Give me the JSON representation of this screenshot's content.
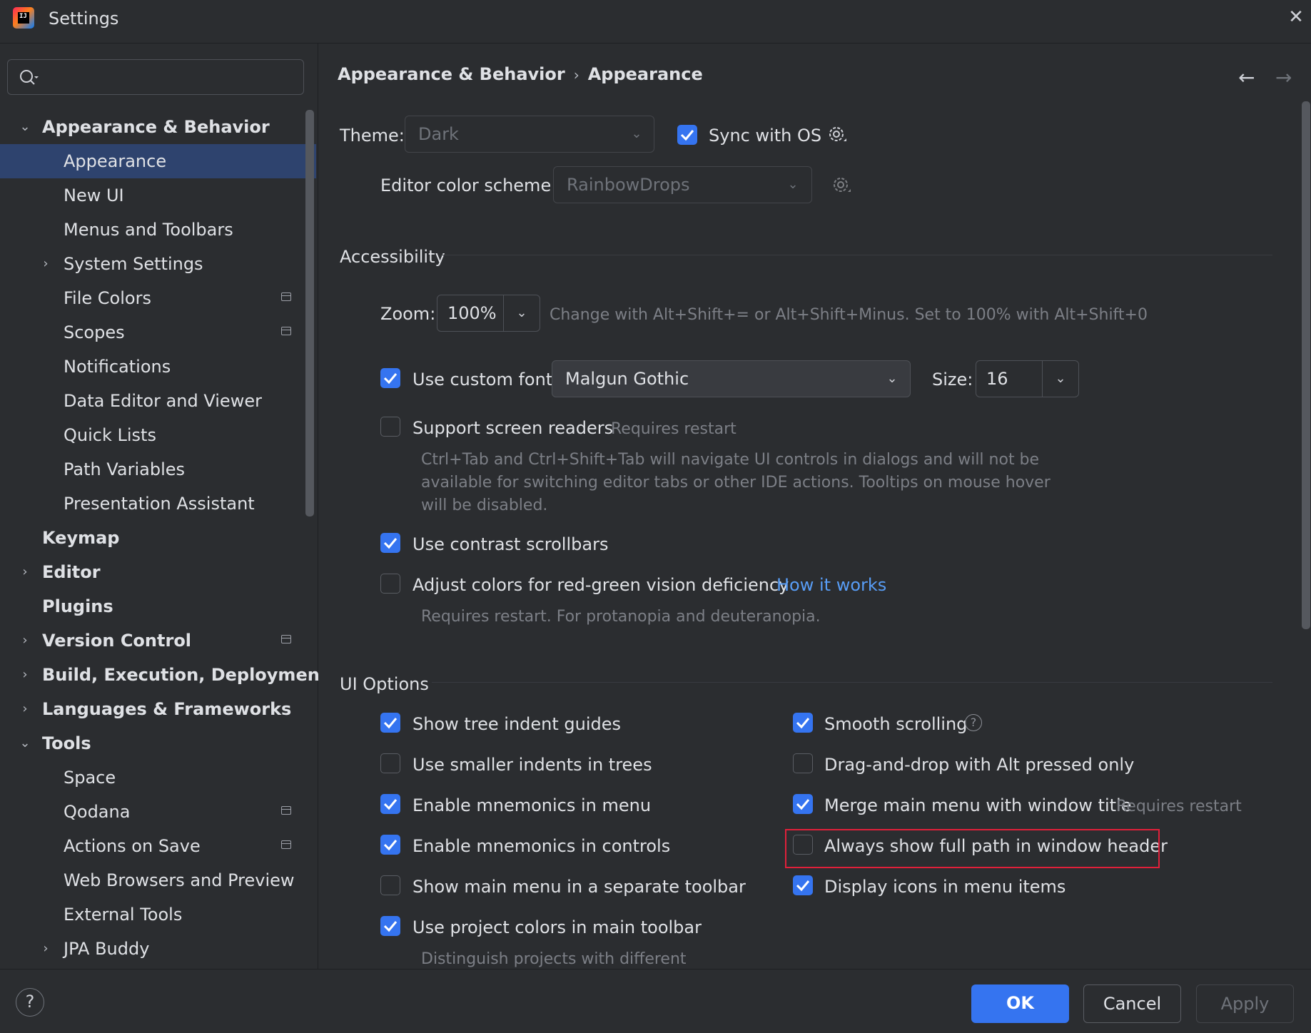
{
  "window": {
    "title": "Settings"
  },
  "search": {
    "placeholder": ""
  },
  "sidebar": {
    "items": [
      {
        "label": "Appearance & Behavior",
        "expanded": true
      },
      {
        "label": "Appearance",
        "selected": true
      },
      {
        "label": "New UI"
      },
      {
        "label": "Menus and Toolbars"
      },
      {
        "label": "System Settings"
      },
      {
        "label": "File Colors"
      },
      {
        "label": "Scopes"
      },
      {
        "label": "Notifications"
      },
      {
        "label": "Data Editor and Viewer"
      },
      {
        "label": "Quick Lists"
      },
      {
        "label": "Path Variables"
      },
      {
        "label": "Presentation Assistant"
      },
      {
        "label": "Keymap"
      },
      {
        "label": "Editor"
      },
      {
        "label": "Plugins"
      },
      {
        "label": "Version Control"
      },
      {
        "label": "Build, Execution, Deployment"
      },
      {
        "label": "Languages & Frameworks"
      },
      {
        "label": "Tools",
        "expanded": true
      },
      {
        "label": "Space"
      },
      {
        "label": "Qodana"
      },
      {
        "label": "Actions on Save"
      },
      {
        "label": "Web Browsers and Preview"
      },
      {
        "label": "External Tools"
      },
      {
        "label": "JPA Buddy"
      }
    ]
  },
  "breadcrumb": {
    "parent": "Appearance & Behavior",
    "current": "Appearance"
  },
  "theme": {
    "label": "Theme:",
    "value": "Dark",
    "sync_label": "Sync with OS",
    "sync_checked": true
  },
  "editor_scheme": {
    "label": "Editor color scheme:",
    "value": "RainbowDrops"
  },
  "accessibility": {
    "section_title": "Accessibility",
    "zoom_label": "Zoom:",
    "zoom_value": "100%",
    "zoom_hint": "Change with Alt+Shift+= or Alt+Shift+Minus. Set to 100% with Alt+Shift+0",
    "custom_font_label": "Use custom font:",
    "custom_font_checked": true,
    "font_value": "Malgun Gothic",
    "size_label": "Size:",
    "size_value": "16",
    "screen_readers_label": "Support screen readers",
    "screen_readers_checked": false,
    "screen_readers_hint": "Requires restart",
    "screen_readers_desc_1": "Ctrl+Tab and Ctrl+Shift+Tab will navigate UI controls in dialogs and will not be",
    "screen_readers_desc_2": "available for switching editor tabs or other IDE actions. Tooltips on mouse hover",
    "screen_readers_desc_3": "will be disabled.",
    "contrast_scrollbars_label": "Use contrast scrollbars",
    "contrast_scrollbars_checked": true,
    "red_green_label": "Adjust colors for red-green vision deficiency",
    "red_green_checked": false,
    "how_it_works": "How it works",
    "red_green_hint": "Requires restart. For protanopia and deuteranopia."
  },
  "ui_options": {
    "section_title": "UI Options",
    "left": [
      {
        "label": "Show tree indent guides",
        "checked": true
      },
      {
        "label": "Use smaller indents in trees",
        "checked": false
      },
      {
        "label": "Enable mnemonics in menu",
        "checked": true
      },
      {
        "label": "Enable mnemonics in controls",
        "checked": true
      },
      {
        "label": "Show main menu in a separate toolbar",
        "checked": false
      },
      {
        "label": "Use project colors in main toolbar",
        "checked": true
      }
    ],
    "project_colors_hint": "Distinguish projects with different",
    "right": [
      {
        "label": "Smooth scrolling",
        "checked": true
      },
      {
        "label": "Drag-and-drop with Alt pressed only",
        "checked": false
      },
      {
        "label": "Merge main menu with window title",
        "checked": true
      },
      {
        "label": "Always show full path in window header",
        "checked": false
      },
      {
        "label": "Display icons in menu items",
        "checked": true
      }
    ],
    "merge_hint": "Requires restart"
  },
  "buttons": {
    "ok": "OK",
    "cancel": "Cancel",
    "apply": "Apply",
    "help": "?"
  },
  "colors": {
    "accent": "#3574f0",
    "background": "#2b2d30",
    "selection": "#2e436e",
    "highlight": "#e0203a",
    "link": "#589df6"
  }
}
